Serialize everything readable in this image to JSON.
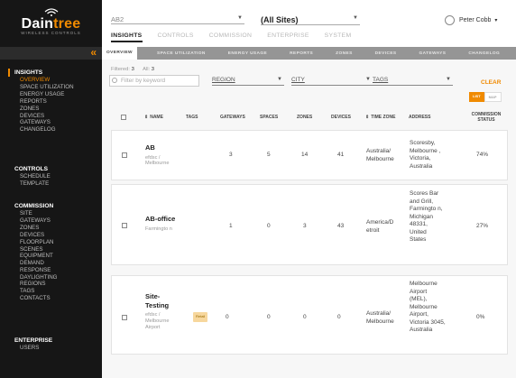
{
  "brand": {
    "name_main": "Dain",
    "name_accent": "tree",
    "subtitle": "WIRELESS CONTROLS"
  },
  "sidebar": {
    "collapse_icon": "«",
    "groups": [
      {
        "title": "INSIGHTS",
        "items": [
          "OVERVIEW",
          "SPACE UTILIZATION",
          "ENERGY USAGE",
          "REPORTS",
          "ZONES",
          "DEVICES",
          "GATEWAYS",
          "CHANGELOG"
        ],
        "active": 0
      },
      {
        "title": "CONTROLS",
        "items": [
          "SCHEDULE",
          "TEMPLATE"
        ]
      },
      {
        "title": "COMMISSION",
        "items": [
          "SITE",
          "GATEWAYS",
          "ZONES",
          "DEVICES",
          "FLOORPLAN",
          "SCENES",
          "EQUIPMENT",
          "DEMAND RESPONSE",
          "DAYLIGHTING",
          "REGIONS",
          "TAGS",
          "CONTACTS"
        ]
      },
      {
        "title": "ENTERPRISE",
        "items": [
          "USERS"
        ]
      }
    ]
  },
  "header": {
    "site_select": "AB2",
    "sites_select": "(All Sites)",
    "user_name": "Peter Cobb",
    "user_caret": "▾",
    "tabs": [
      "INSIGHTS",
      "CONTROLS",
      "COMMISSION",
      "ENTERPRISE",
      "SYSTEM"
    ],
    "active_tab": 0,
    "subtabs": [
      "OVERVIEW",
      "SPACE UTILIZATION",
      "ENERGY USAGE",
      "REPORTS",
      "ZONES",
      "DEVICES",
      "GATEWAYS",
      "CHANGELOG"
    ],
    "active_subtab": 0
  },
  "filters": {
    "filtered_label": "Filtered:",
    "filtered_count": "3",
    "all_label": "All:",
    "all_count": "3",
    "search_placeholder": "Filter by keyword",
    "region_label": "REGION",
    "city_label": "CITY",
    "tags_label": "TAGS",
    "clear_label": "CLEAR",
    "view_list": "LIST",
    "view_map": "MAP"
  },
  "table": {
    "columns": [
      "NAME",
      "TAGS",
      "GATEWAYS",
      "SPACES",
      "ZONES",
      "DEVICES",
      "TIME ZONE",
      "ADDRESS",
      "COMMISSION STATUS"
    ],
    "sort_icon": "⇕",
    "rows": [
      {
        "name": "AB",
        "location": "efdsc / Melbourne",
        "tags": "",
        "gateways": "3",
        "spaces": "5",
        "zones": "14",
        "devices": "41",
        "timezone": "Australia/ Melbourne",
        "address": "Scoresby, Melbourne , Victoria, Australia",
        "status": "74%"
      },
      {
        "name": "AB-office",
        "location": "Farmingto n",
        "tags": "",
        "gateways": "1",
        "spaces": "0",
        "zones": "3",
        "devices": "43",
        "timezone": "America/D etroit",
        "address": "Scores Bar and Grill, Farmingto n, Michigan 48331, United States",
        "status": "27%"
      },
      {
        "name": "Site-Testing",
        "location": "efdsc / Melbourne Airport",
        "tags": "Retail",
        "gateways": "0",
        "spaces": "0",
        "zones": "0",
        "devices": "0",
        "timezone": "Australia/ Melbourne",
        "address": "Melbourne Airport (MEL), Melbourne Airport, Victoria 3045, Australia",
        "status": "0%"
      }
    ]
  },
  "colors": {
    "accent": "#f08a00",
    "sidebar_bg": "#161616",
    "subbar_bg": "#959595"
  }
}
